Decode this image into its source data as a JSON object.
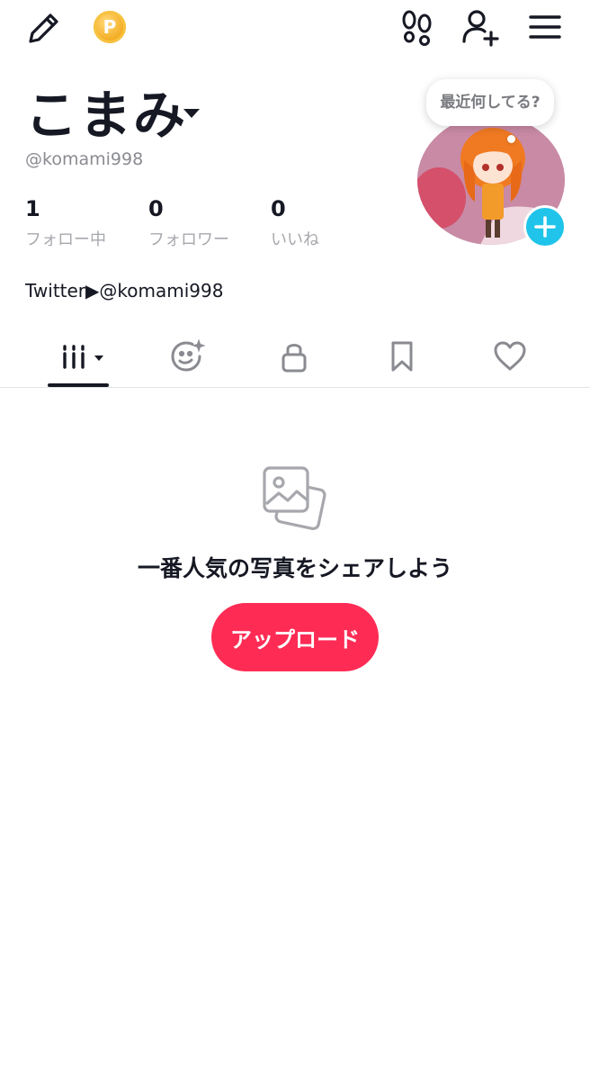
{
  "header": {
    "icons": [
      "pencil-icon",
      "coin-icon",
      "footprints-icon",
      "add-friend-icon",
      "menu-icon"
    ],
    "coin_letter": "P"
  },
  "profile": {
    "display_name": "こまみ",
    "username": "@komami998",
    "status_bubble": "最近何してる?",
    "bio": "Twitter▶@komami998"
  },
  "stats": [
    {
      "value": "1",
      "label": "フォロー中"
    },
    {
      "value": "0",
      "label": "フォロワー"
    },
    {
      "value": "0",
      "label": "いいね"
    }
  ],
  "tabs": [
    {
      "name": "videos",
      "icon": "grid-icon",
      "selected": true
    },
    {
      "name": "reposts",
      "icon": "face-sparkle-icon",
      "selected": false
    },
    {
      "name": "private",
      "icon": "lock-icon",
      "selected": false
    },
    {
      "name": "favorites",
      "icon": "bookmark-icon",
      "selected": false
    },
    {
      "name": "liked",
      "icon": "heart-icon",
      "selected": false
    }
  ],
  "empty_state": {
    "icon": "photos-icon",
    "title": "一番人気の写真をシェアしよう",
    "button_label": "アップロード"
  },
  "colors": {
    "accent": "#fe2c55",
    "avatar_add": "#20c4ea",
    "text": "#161823",
    "muted": "#a7a8ad"
  }
}
